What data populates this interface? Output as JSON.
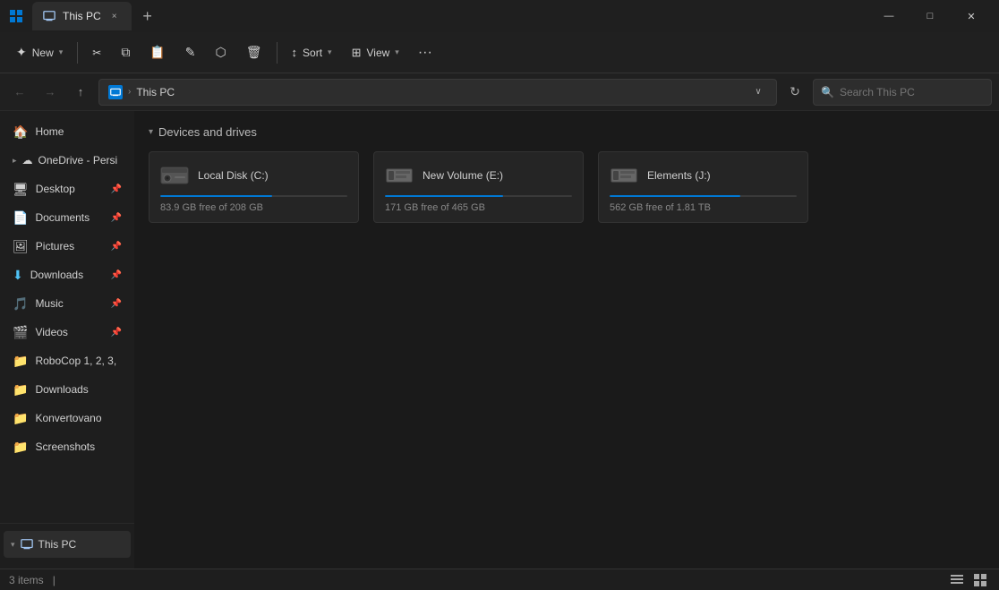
{
  "window": {
    "title": "This PC",
    "tab_label": "This PC",
    "tab_close": "×",
    "tab_new": "+",
    "minimize": "—",
    "maximize": "□",
    "close": "✕"
  },
  "toolbar": {
    "new_label": "New",
    "cut_icon": "✂",
    "copy_icon": "⧉",
    "paste_icon": "📋",
    "rename_icon": "✎",
    "share_icon": "⬡",
    "delete_icon": "🗑",
    "sort_label": "Sort",
    "view_label": "View",
    "more_label": "···"
  },
  "addressbar": {
    "back_icon": "←",
    "forward_icon": "→",
    "up_icon": "↑",
    "address_icon": "💻",
    "breadcrumb_sep": "›",
    "path": "This PC",
    "dropdown_icon": "∨",
    "refresh_icon": "↻",
    "search_placeholder": "Search This PC",
    "search_icon": "🔍"
  },
  "sidebar": {
    "home": {
      "label": "Home",
      "icon": "🏠"
    },
    "onedrive": {
      "label": "OneDrive - Persi",
      "icon": "☁"
    },
    "items": [
      {
        "label": "Desktop",
        "icon": "🖥",
        "pinned": true
      },
      {
        "label": "Documents",
        "icon": "📄",
        "pinned": true
      },
      {
        "label": "Pictures",
        "icon": "🖼",
        "pinned": true
      },
      {
        "label": "Downloads",
        "icon": "⬇",
        "pinned": true
      },
      {
        "label": "Music",
        "icon": "🎵",
        "pinned": true
      },
      {
        "label": "Videos",
        "icon": "🎬",
        "pinned": true
      },
      {
        "label": "RoboCop 1, 2, 3,",
        "icon": "📁",
        "pinned": false
      },
      {
        "label": "Downloads",
        "icon": "📁",
        "pinned": false
      },
      {
        "label": "Konvertovano",
        "icon": "📁",
        "pinned": false
      },
      {
        "label": "Screenshots",
        "icon": "📁",
        "pinned": false
      }
    ],
    "this_pc": {
      "label": "This PC",
      "icon": "💻"
    }
  },
  "content": {
    "section_title": "Devices and drives",
    "collapse_icon": "▾",
    "drives": [
      {
        "name": "Local Disk (C:)",
        "free": "83.9 GB free of 208 GB",
        "bar_pct": 60,
        "bar_color": "#0078d4"
      },
      {
        "name": "New Volume (E:)",
        "free": "171 GB free of 465 GB",
        "bar_pct": 63,
        "bar_color": "#0078d4"
      },
      {
        "name": "Elements (J:)",
        "free": "562 GB free of 1.81 TB",
        "bar_pct": 70,
        "bar_color": "#0078d4"
      }
    ]
  },
  "statusbar": {
    "count": "3 items",
    "sep": "|"
  }
}
